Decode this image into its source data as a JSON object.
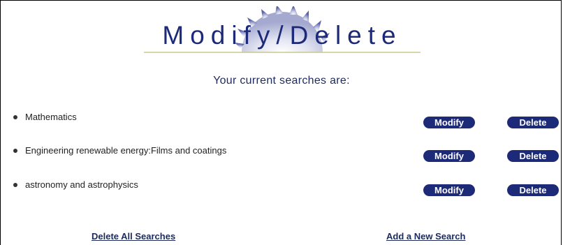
{
  "header": {
    "title": "Modify/Delete",
    "logo_icon": "sunburst-logo-icon",
    "accent_color": "#1d2a78"
  },
  "subtitle": "Your current searches are:",
  "searches": [
    {
      "label": "Mathematics",
      "modify_label": "Modify",
      "delete_label": "Delete"
    },
    {
      "label": "Engineering renewable energy:Films and coatings",
      "modify_label": "Modify",
      "delete_label": "Delete"
    },
    {
      "label": "astronomy and astrophysics",
      "modify_label": "Modify",
      "delete_label": "Delete"
    }
  ],
  "footer": {
    "delete_all_label": "Delete All Searches",
    "add_new_label": "Add a New Search"
  }
}
